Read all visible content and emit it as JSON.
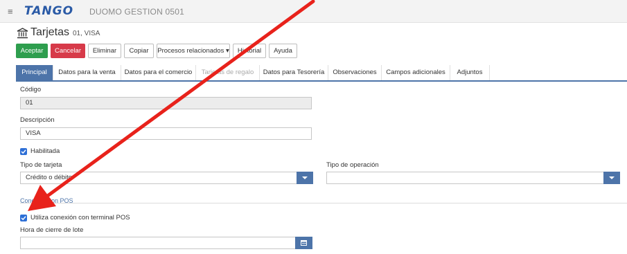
{
  "header": {
    "logo": "TANGO",
    "company": "DUOMO GESTION 0501",
    "menu_icon": "hamburger-icon"
  },
  "page": {
    "title": "Tarjetas",
    "subtitle": "01, VISA",
    "title_icon": "bank-icon"
  },
  "toolbar": {
    "accept": "Aceptar",
    "cancel": "Cancelar",
    "delete": "Eliminar",
    "copy": "Copiar",
    "processes": "Procesos relacionados ▾",
    "history": "Historial",
    "help": "Ayuda"
  },
  "tabs": [
    {
      "label": "Principal"
    },
    {
      "label": "Datos para la venta"
    },
    {
      "label": "Datos para el comercio"
    },
    {
      "label": "Tarjetas de regalo"
    },
    {
      "label": "Datos para Tesorería"
    },
    {
      "label": "Observaciones"
    },
    {
      "label": "Campos adicionales"
    },
    {
      "label": "Adjuntos"
    }
  ],
  "form": {
    "codigo_label": "Código",
    "codigo_value": "01",
    "descripcion_label": "Descripción",
    "descripcion_value": "VISA",
    "habilitada_label": "Habilitada",
    "habilitada_checked": true,
    "tipo_tarjeta_label": "Tipo de tarjeta",
    "tipo_tarjeta_value": "Crédito o débito",
    "tipo_operacion_label": "Tipo de operación",
    "tipo_operacion_value": "",
    "section_pos": "Conexión con POS",
    "utiliza_pos_label": "Utiliza conexión con terminal POS",
    "utiliza_pos_checked": true,
    "hora_cierre_label": "Hora de cierre de lote",
    "hora_cierre_value": ""
  },
  "annotation": {
    "arrow_color": "#e8221b"
  },
  "colors": {
    "accent": "#4d74a9",
    "accept": "#2e9e4e",
    "cancel": "#d73a49",
    "checkbox": "#2e6fd6"
  }
}
